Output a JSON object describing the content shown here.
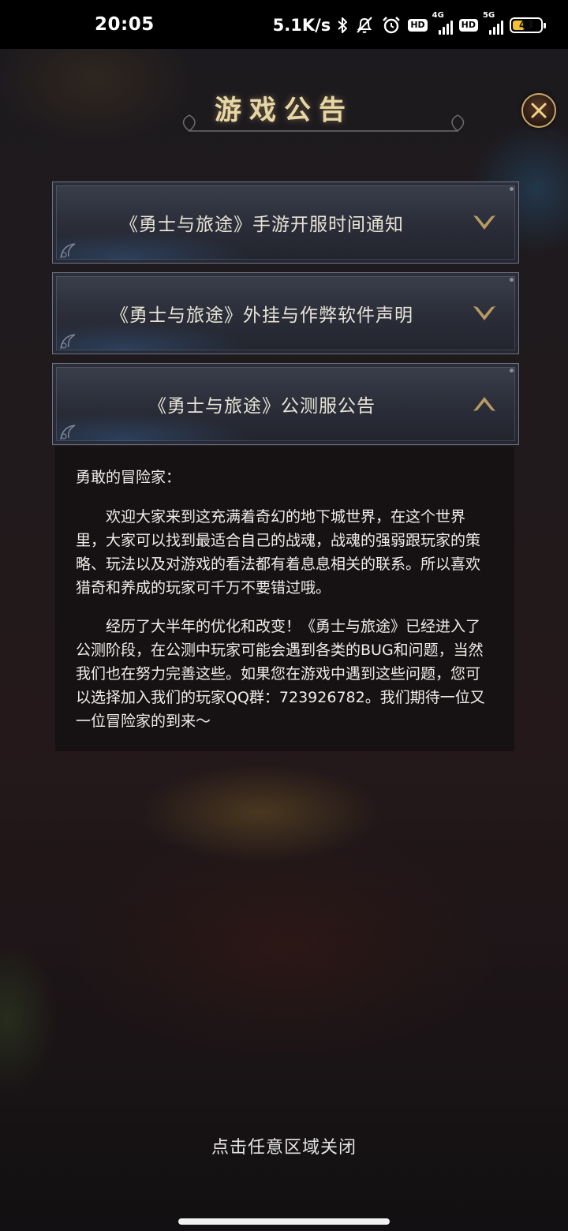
{
  "status_bar": {
    "time": "20:05",
    "net_speed": "5.1K/s",
    "network_1": "4G",
    "network_2": "5G",
    "hd_label": "HD",
    "battery": "43",
    "battery_level": 0.43,
    "icons": [
      "bluetooth-icon",
      "mute-icon",
      "alarm-icon",
      "signal-icon",
      "battery-icon"
    ]
  },
  "dialog": {
    "title": "游戏公告",
    "close_icon": "close-icon"
  },
  "notices": [
    {
      "title": "《勇士与旅途》手游开服时间通知",
      "expanded": false,
      "chevron": "chevron-down-icon"
    },
    {
      "title": "《勇士与旅途》外挂与作弊软件声明",
      "expanded": false,
      "chevron": "chevron-down-icon"
    },
    {
      "title": "《勇士与旅途》公测服公告",
      "expanded": true,
      "chevron": "chevron-up-icon"
    }
  ],
  "content": {
    "greeting": "勇敢的冒险家：",
    "paragraphs": [
      "欢迎大家来到这充满着奇幻的地下城世界，在这个世界里，大家可以找到最适合自己的战魂，战魂的强弱跟玩家的策略、玩法以及对游戏的看法都有着息息相关的联系。所以喜欢猎奇和养成的玩家可千万不要错过哦。",
      "经历了大半年的优化和改变！《勇士与旅途》已经进入了公测阶段，在公测中玩家可能会遇到各类的BUG和问题，当然我们也在努力完善这些。如果您在游戏中遇到这些问题，您可以选择加入我们的玩家QQ群：723926782。我们期待一位又一位冒险家的到来～"
    ]
  },
  "footer": {
    "dismiss_hint": "点击任意区域关闭"
  },
  "colors": {
    "gold": "#e8d7a6",
    "panel": "#2a2d38",
    "text": "#efeeea"
  }
}
